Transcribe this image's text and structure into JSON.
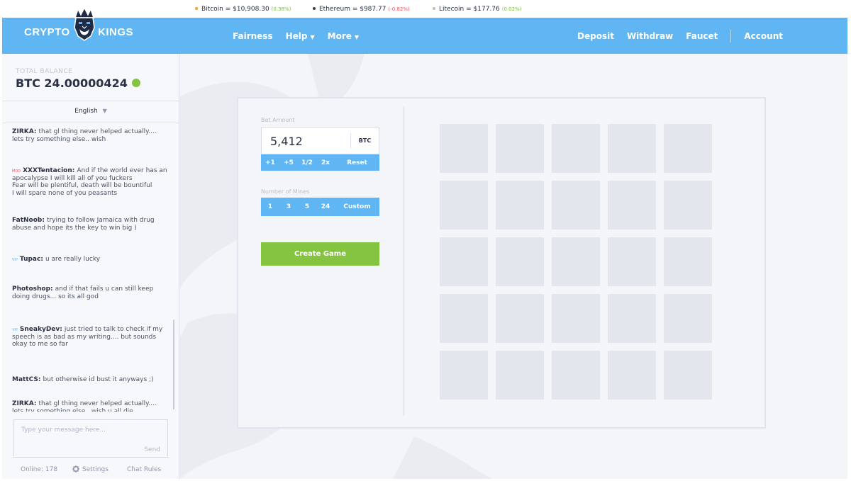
{
  "ticker": [
    {
      "name": "Bitcoin",
      "price": "$10,908.30",
      "change": "(0.38%)",
      "direction": "up",
      "dot_color": "#f5a623"
    },
    {
      "name": "Ethereum",
      "price": "$987.77",
      "change": "(-0.82%)",
      "direction": "down",
      "dot_color": "#3c3c3d"
    },
    {
      "name": "Litecoin",
      "price": "$177.76",
      "change": "(0.02%)",
      "direction": "up",
      "dot_color": "#bebebe"
    }
  ],
  "header": {
    "logo_left": "CRYPTO",
    "logo_right": "KINGS",
    "nav_left": [
      "Fairness",
      "Help",
      "More"
    ],
    "nav_right": [
      "Deposit",
      "Withdraw",
      "Faucet",
      "Account"
    ]
  },
  "sidebar": {
    "balance_label": "TOTAL BALANCE",
    "balance_value": "BTC 24.00000424",
    "language": "English",
    "chat_placeholder": "Type your message here...",
    "send_label": "Send",
    "online": "Online: 178",
    "settings_label": "Settings",
    "rules_label": "Chat Rules"
  },
  "chat": [
    {
      "tag": "",
      "user": "ZIRKA:",
      "lines": [
        "that gl thing never helped actually....",
        "lets try something else.. wish"
      ]
    },
    {
      "tag": "MOD",
      "user": "XXXTentacion:",
      "lines": [
        "And if the world ever has an",
        "apocalypse I will kill all of you fuckers",
        "Fear will be plentiful, death will be bountiful",
        "I will spare none of you peasants"
      ]
    },
    {
      "tag": "",
      "user": "FatNoob:",
      "lines": [
        "trying to follow Jamaica with drug",
        "abuse and hope its the key to win big )"
      ]
    },
    {
      "tag": "VIP",
      "user": "Tupac:",
      "lines": [
        "u are really lucky"
      ]
    },
    {
      "tag": "",
      "user": "Photoshop:",
      "lines": [
        "and if that fails u can still keep",
        "doing drugs... so its all god"
      ]
    },
    {
      "tag": "VIP",
      "user": "SneakyDev:",
      "lines": [
        "just tried to talk to check if my",
        "speech is as bad as my writing.... but sounds",
        "okay to me so far"
      ]
    },
    {
      "tag": "",
      "user": "MattCS:",
      "lines": [
        "but otherwise id bust it anyways ;)"
      ]
    },
    {
      "tag": "",
      "user": "ZIRKA:",
      "lines": [
        "that gl thing never helped actually....",
        "lets try something else.. wish u all die."
      ]
    }
  ],
  "game": {
    "bet_label": "Bet Amount",
    "bet_value": "5,412",
    "bet_unit": "BTC",
    "bet_buttons": [
      "+1",
      "+5",
      "1/2",
      "2x",
      "Reset"
    ],
    "mines_label": "Number of Mines",
    "mine_buttons": [
      "1",
      "3",
      "5",
      "24",
      "Custom"
    ],
    "create_label": "Create Game",
    "grid_rows": 5,
    "grid_cols": 5
  },
  "colors": {
    "header_blue": "#5fb6f3",
    "create_green": "#84c441",
    "tile": "#e4e6ee"
  }
}
